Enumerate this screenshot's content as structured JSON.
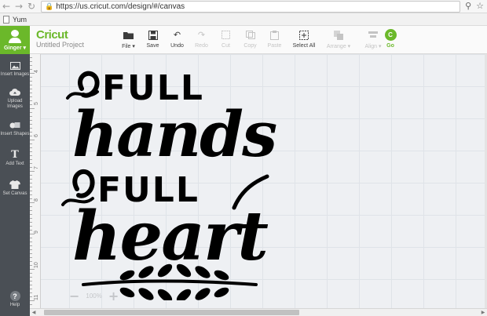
{
  "browser": {
    "url": "https://us.cricut.com/design/#/canvas",
    "back": "←",
    "forward": "→",
    "reload": "↻",
    "bookmark_label": "Yum"
  },
  "app": {
    "brand": "Cricut",
    "project_name": "Untitled Project",
    "user_name": "Ginger ▾",
    "accent_color": "#6bb82a",
    "sidebar_color": "#4a4f55"
  },
  "toolbar": {
    "file": "File ▾",
    "save": "Save",
    "undo": "Undo",
    "redo": "Redo",
    "cut": "Cut",
    "copy": "Copy",
    "paste": "Paste",
    "select_all": "Select All",
    "arrange": "Arrange ▾",
    "align": "Align ▾",
    "go": "Go",
    "go_badge": "C"
  },
  "sidebar": {
    "items": [
      {
        "label": "Insert Images",
        "icon": "image-icon"
      },
      {
        "label": "Upload Images",
        "icon": "cloud-upload-icon"
      },
      {
        "label": "Insert Shapes",
        "icon": "shapes-icon"
      },
      {
        "label": "Add Text",
        "icon": "text-icon"
      },
      {
        "label": "Set Canvas",
        "icon": "shirt-icon"
      }
    ],
    "help": "Help"
  },
  "ruler": {
    "marks": [
      "4",
      "5",
      "6",
      "7",
      "8",
      "9",
      "10",
      "11"
    ]
  },
  "canvas": {
    "lines": [
      "FULL",
      "hands",
      "FULL",
      "heart"
    ]
  },
  "zoom": {
    "minus": "−",
    "value": "100%",
    "plus": "+"
  }
}
